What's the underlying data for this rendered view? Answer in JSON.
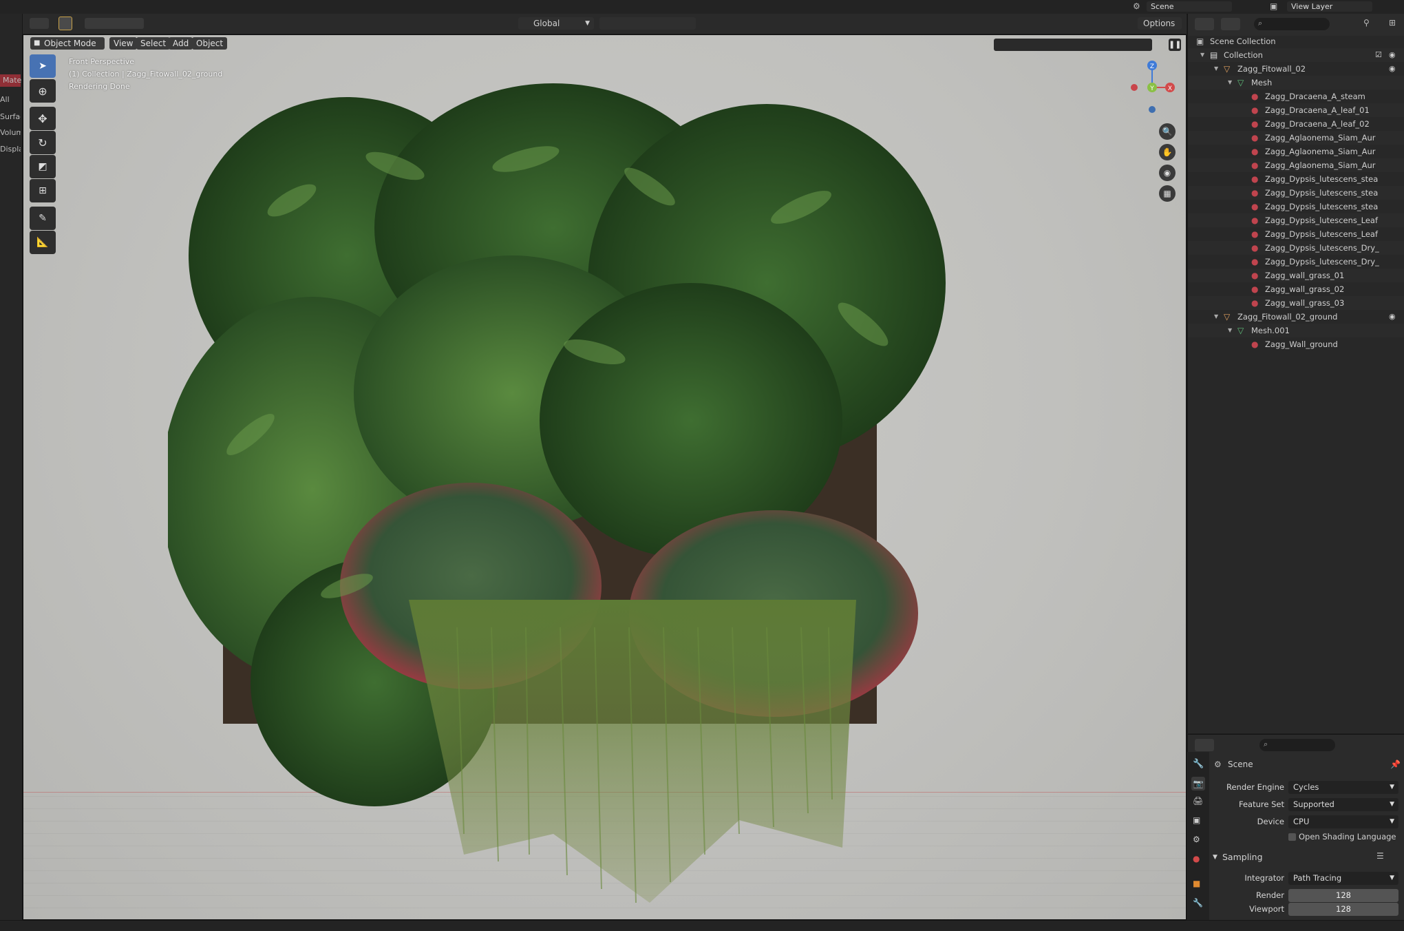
{
  "topbar": {
    "scene": "Scene",
    "view_layer": "View Layer"
  },
  "viewport_header": {
    "transform_orientation": "Global",
    "options": "Options"
  },
  "header2": {
    "mode": "Object Mode",
    "menus": [
      "View",
      "Select",
      "Add",
      "Object"
    ]
  },
  "overlay": {
    "perspective": "Front Perspective",
    "collection": "(1) Collection | Zagg_Fitowall_02_ground",
    "status": "Rendering Done"
  },
  "gizmo": {
    "z": "Z",
    "y": "Y",
    "x": "X"
  },
  "left_strip": {
    "labels": [
      "Mate",
      "All",
      "Surface",
      "Volum",
      "Displac"
    ]
  },
  "outliner": {
    "rows": [
      {
        "label": "Scene Collection",
        "indent": 0,
        "icon": "scene-collection-icon",
        "eye": false
      },
      {
        "label": "Collection",
        "indent": 1,
        "icon": "collection-icon",
        "eye": true
      },
      {
        "label": "Zagg_Fitowall_02",
        "indent": 2,
        "icon": "object-icon",
        "eye": true
      },
      {
        "label": "Mesh",
        "indent": 3,
        "icon": "mesh-icon",
        "eye": false
      },
      {
        "label": "Zagg_Dracaena_A_steam",
        "indent": 4,
        "icon": "material-icon",
        "eye": false
      },
      {
        "label": "Zagg_Dracaena_A_leaf_01",
        "indent": 4,
        "icon": "material-icon",
        "eye": false
      },
      {
        "label": "Zagg_Dracaena_A_leaf_02",
        "indent": 4,
        "icon": "material-icon",
        "eye": false
      },
      {
        "label": "Zagg_Aglaonema_Siam_Aur",
        "indent": 4,
        "icon": "material-icon",
        "eye": false
      },
      {
        "label": "Zagg_Aglaonema_Siam_Aur",
        "indent": 4,
        "icon": "material-icon",
        "eye": false
      },
      {
        "label": "Zagg_Aglaonema_Siam_Aur",
        "indent": 4,
        "icon": "material-icon",
        "eye": false
      },
      {
        "label": "Zagg_Dypsis_lutescens_stea",
        "indent": 4,
        "icon": "material-icon",
        "eye": false
      },
      {
        "label": "Zagg_Dypsis_lutescens_stea",
        "indent": 4,
        "icon": "material-icon",
        "eye": false
      },
      {
        "label": "Zagg_Dypsis_lutescens_stea",
        "indent": 4,
        "icon": "material-icon",
        "eye": false
      },
      {
        "label": "Zagg_Dypsis_lutescens_Leaf",
        "indent": 4,
        "icon": "material-icon",
        "eye": false
      },
      {
        "label": "Zagg_Dypsis_lutescens_Leaf",
        "indent": 4,
        "icon": "material-icon",
        "eye": false
      },
      {
        "label": "Zagg_Dypsis_lutescens_Dry_",
        "indent": 4,
        "icon": "material-icon",
        "eye": false
      },
      {
        "label": "Zagg_Dypsis_lutescens_Dry_",
        "indent": 4,
        "icon": "material-icon",
        "eye": false
      },
      {
        "label": "Zagg_wall_grass_01",
        "indent": 4,
        "icon": "material-icon",
        "eye": false
      },
      {
        "label": "Zagg_wall_grass_02",
        "indent": 4,
        "icon": "material-icon",
        "eye": false
      },
      {
        "label": "Zagg_wall_grass_03",
        "indent": 4,
        "icon": "material-icon",
        "eye": false
      },
      {
        "label": "Zagg_Fitowall_02_ground",
        "indent": 2,
        "icon": "object-icon",
        "eye": true
      },
      {
        "label": "Mesh.001",
        "indent": 3,
        "icon": "mesh-icon",
        "eye": false
      },
      {
        "label": "Zagg_Wall_ground",
        "indent": 4,
        "icon": "material-icon",
        "eye": false
      }
    ]
  },
  "properties": {
    "context": "Scene",
    "render_engine_label": "Render Engine",
    "render_engine": "Cycles",
    "feature_set_label": "Feature Set",
    "feature_set": "Supported",
    "device_label": "Device",
    "device": "CPU",
    "osl_label": "Open Shading Language",
    "sampling_label": "Sampling",
    "integrator_label": "Integrator",
    "integrator": "Path Tracing",
    "render_label": "Render",
    "render_samples": "128",
    "viewport_label": "Viewport",
    "viewport_samples": "128"
  },
  "colors": {
    "accent": "#4772b3",
    "material": "#c0444e",
    "object": "#e0a060",
    "mesh": "#5fbf7a"
  }
}
